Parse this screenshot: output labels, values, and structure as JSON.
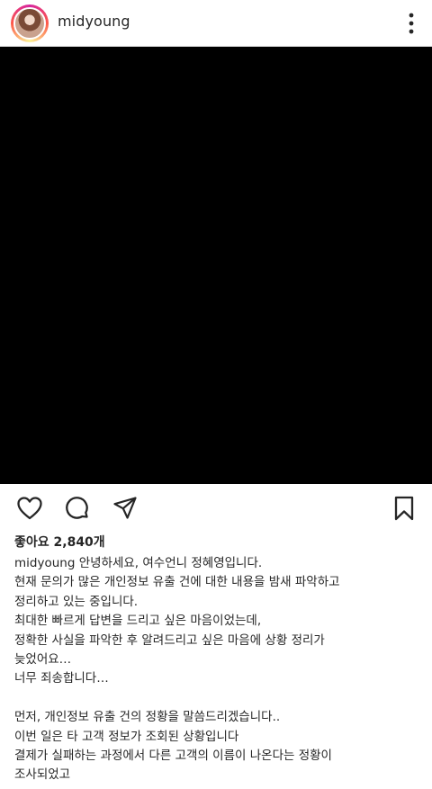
{
  "post": {
    "username": "midyoung",
    "likes_text": "좋아요 2,840개",
    "caption_user": "midyoung",
    "caption_lines": [
      "안녕하세요, 여수언니 정혜영입니다.",
      "현재 문의가 많은 개인정보 유출 건에 대한 내용을 밤새 파악하고",
      "정리하고 있는 중입니다.",
      "최대한 빠르게 답변을 드리고 싶은 마음이었는데,",
      "정확한 사실을 파악한 후 알려드리고 싶은 마음에 상황 정리가",
      "늦었어요…",
      "너무 죄송합니다…",
      "",
      "먼저, 개인정보 유출 건의 정황을 말씀드리겠습니다..",
      "이번 일은 타 고객 정보가 조회된 상황입니다",
      "결제가 실패하는 과정에서 다른 고객의 이름이 나온다는 정황이",
      "조사되었고"
    ]
  },
  "icons": {
    "more": "more-vertical-icon",
    "like": "heart-icon",
    "comment": "comment-icon",
    "share": "paper-plane-icon",
    "save": "bookmark-icon"
  },
  "colors": {
    "text": "#262626",
    "media": "#000000",
    "divider": "#dbdbdb"
  }
}
